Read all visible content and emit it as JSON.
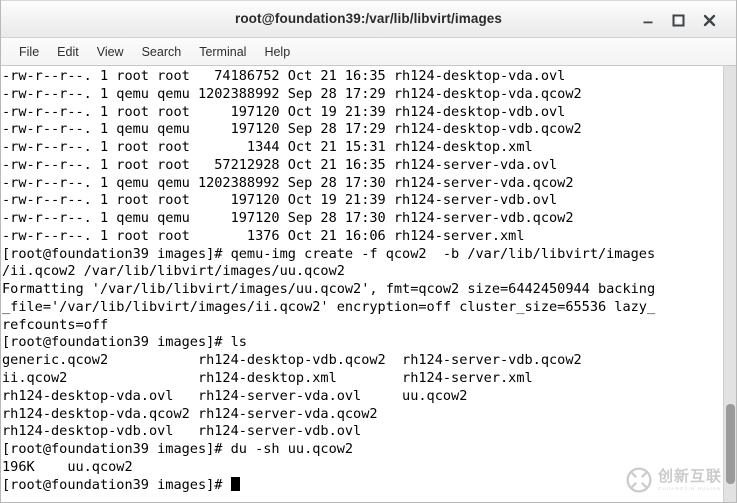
{
  "window": {
    "title": "root@foundation39:/var/lib/libvirt/images",
    "controls": {
      "minimize_label": "–",
      "maximize_label": "□",
      "close_label": "×"
    }
  },
  "menubar": {
    "items": [
      {
        "label": "File"
      },
      {
        "label": "Edit"
      },
      {
        "label": "View"
      },
      {
        "label": "Search"
      },
      {
        "label": "Terminal"
      },
      {
        "label": "Help"
      }
    ]
  },
  "terminal": {
    "prompt": "[root@foundation39 images]#",
    "lines": [
      "-rw-r--r--. 1 root root   74186752 Oct 21 16:35 rh124-desktop-vda.ovl",
      "-rw-r--r--. 1 qemu qemu 1202388992 Sep 28 17:29 rh124-desktop-vda.qcow2",
      "-rw-r--r--. 1 root root     197120 Oct 19 21:39 rh124-desktop-vdb.ovl",
      "-rw-r--r--. 1 qemu qemu     197120 Sep 28 17:29 rh124-desktop-vdb.qcow2",
      "-rw-r--r--. 1 root root       1344 Oct 21 15:31 rh124-desktop.xml",
      "-rw-r--r--. 1 root root   57212928 Oct 21 16:35 rh124-server-vda.ovl",
      "-rw-r--r--. 1 qemu qemu 1202388992 Sep 28 17:30 rh124-server-vda.qcow2",
      "-rw-r--r--. 1 root root     197120 Oct 19 21:39 rh124-server-vdb.ovl",
      "-rw-r--r--. 1 qemu qemu     197120 Sep 28 17:30 rh124-server-vdb.qcow2",
      "-rw-r--r--. 1 root root       1376 Oct 21 16:06 rh124-server.xml",
      "[root@foundation39 images]# qemu-img create -f qcow2  -b /var/lib/libvirt/images",
      "/ii.qcow2 /var/lib/libvirt/images/uu.qcow2",
      "Formatting '/var/lib/libvirt/images/uu.qcow2', fmt=qcow2 size=6442450944 backing",
      "_file='/var/lib/libvirt/images/ii.qcow2' encryption=off cluster_size=65536 lazy_",
      "refcounts=off",
      "[root@foundation39 images]# ls",
      "generic.qcow2           rh124-desktop-vdb.qcow2  rh124-server-vdb.qcow2",
      "ii.qcow2                rh124-desktop.xml        rh124-server.xml",
      "rh124-desktop-vda.ovl   rh124-server-vda.ovl     uu.qcow2",
      "rh124-desktop-vda.qcow2 rh124-server-vda.qcow2",
      "rh124-desktop-vdb.ovl   rh124-server-vdb.ovl",
      "[root@foundation39 images]# du -sh uu.qcow2",
      "196K    uu.qcow2"
    ],
    "last_line_prompt": "[root@foundation39 images]# "
  },
  "watermark": {
    "cn_text": "创新互联",
    "en_text": "CHUANGXIN HULIAN"
  },
  "colors": {
    "terminal_background": "#ffffff",
    "terminal_foreground": "#000000",
    "titlebar_background": "#f2f2f2",
    "scrollbar_thumb": "#9b9b9b"
  }
}
